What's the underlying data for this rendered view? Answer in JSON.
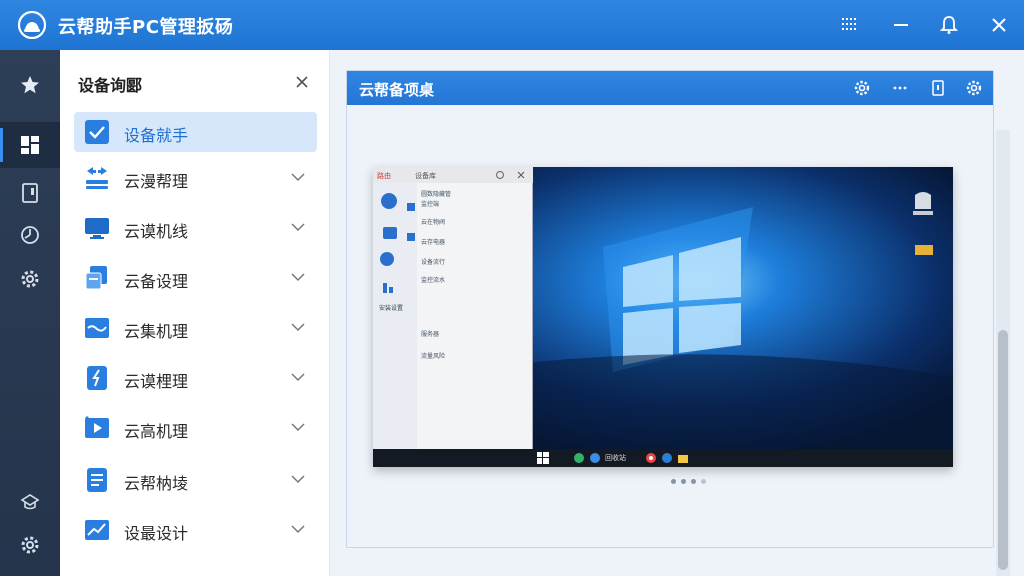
{
  "app": {
    "title": "云帮助手PC管理扳砀",
    "accent": "#1f74d3",
    "rail_bg": "#2d3e57"
  },
  "rail": {
    "items": [
      {
        "icon": "star-icon"
      },
      {
        "icon": "dashboard-icon",
        "active": true
      },
      {
        "icon": "document-icon"
      },
      {
        "icon": "clock-icon"
      },
      {
        "icon": "gear-icon"
      },
      {
        "icon": "hat-icon"
      },
      {
        "icon": "settings-cog-icon"
      }
    ]
  },
  "menu": {
    "heading": "设备询郾",
    "items": [
      {
        "label": "设备就手",
        "icon": "checkbox-icon",
        "active": true
      },
      {
        "label": "云漫帮理",
        "icon": "transfer-icon"
      },
      {
        "label": "云谟机线",
        "icon": "monitor-icon"
      },
      {
        "label": "云备设理",
        "icon": "copy-icon"
      },
      {
        "label": "云集机理",
        "icon": "wave-icon"
      },
      {
        "label": "云谟梩理",
        "icon": "tool-icon"
      },
      {
        "label": "云高机理",
        "icon": "play-icon"
      },
      {
        "label": "云帮枘堎",
        "icon": "list-doc-icon"
      },
      {
        "label": "设最设计",
        "icon": "chart-icon"
      }
    ]
  },
  "panel": {
    "title": "云帮备项桌"
  },
  "preview": {
    "mini_tabs": [
      "路由",
      "设备库"
    ],
    "mini_rows": [
      "圆数隐藏管",
      "监控端",
      "云在物阀",
      "云存电器",
      "设备流行",
      "监控流水"
    ],
    "mini_section": "安装设置",
    "mini_lower": [
      "服务器",
      "流量风险"
    ],
    "taskbar_label": "回收站",
    "page_dots": 4
  }
}
